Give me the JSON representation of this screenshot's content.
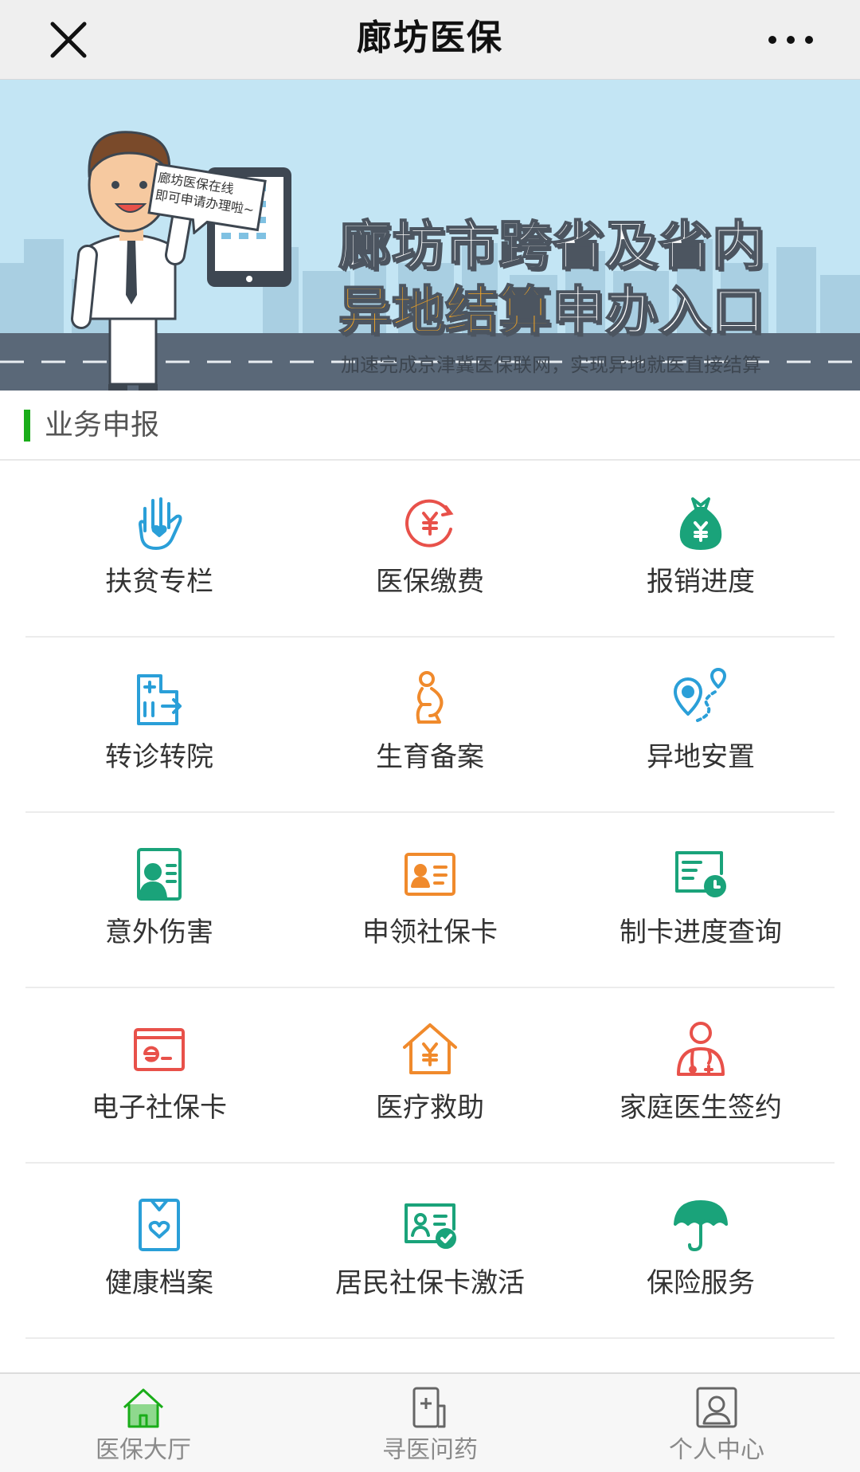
{
  "titlebar": {
    "title": "廊坊医保",
    "close_icon": "close-icon",
    "more_icon": "more-dots-icon"
  },
  "banner": {
    "headline_line1": "廊坊市跨省及省内",
    "headline_line2_highlight": "异地结算",
    "headline_line2_rest": "申办入口",
    "subline": "加速完成京津冀医保联网，实现异地就医直接结算",
    "bubble_line1": "廊坊医保在线",
    "bubble_line2": "即可申请办理啦~",
    "slide_count": 3,
    "active_slide": 2
  },
  "section": {
    "title": "业务申报"
  },
  "services": [
    {
      "label": "扶贫专栏",
      "icon": "hand-heart-icon",
      "color": "#2a9fd8"
    },
    {
      "label": "医保缴费",
      "icon": "yuan-circle-icon",
      "color": "#e8514a"
    },
    {
      "label": "报销进度",
      "icon": "money-bag-icon",
      "color": "#1aa37a"
    },
    {
      "label": "转诊转院",
      "icon": "hospital-transfer-icon",
      "color": "#2a9fd8"
    },
    {
      "label": "生育备案",
      "icon": "pregnant-woman-icon",
      "color": "#f08a2c"
    },
    {
      "label": "异地安置",
      "icon": "location-route-icon",
      "color": "#2a9fd8"
    },
    {
      "label": "意外伤害",
      "icon": "injury-card-icon",
      "color": "#1aa37a"
    },
    {
      "label": "申领社保卡",
      "icon": "id-card-icon",
      "color": "#f08a2c"
    },
    {
      "label": "制卡进度查询",
      "icon": "card-clock-icon",
      "color": "#1aa37a"
    },
    {
      "label": "电子社保卡",
      "icon": "e-card-icon",
      "color": "#e8514a"
    },
    {
      "label": "医疗救助",
      "icon": "house-yuan-icon",
      "color": "#f08a2c"
    },
    {
      "label": "家庭医生签约",
      "icon": "doctor-icon",
      "color": "#e8514a"
    },
    {
      "label": "健康档案",
      "icon": "health-file-icon",
      "color": "#2a9fd8"
    },
    {
      "label": "居民社保卡激活",
      "icon": "card-check-icon",
      "color": "#1aa37a"
    },
    {
      "label": "保险服务",
      "icon": "umbrella-icon",
      "color": "#1aa37a"
    }
  ],
  "tabs": [
    {
      "label": "医保大厅",
      "icon": "home-icon",
      "active": true
    },
    {
      "label": "寻医问药",
      "icon": "phone-medical-icon",
      "active": false
    },
    {
      "label": "个人中心",
      "icon": "person-icon",
      "active": false
    }
  ],
  "colors": {
    "accent": "#1aad19",
    "banner_sky": "#bfe3f3",
    "road": "#5a6878"
  }
}
